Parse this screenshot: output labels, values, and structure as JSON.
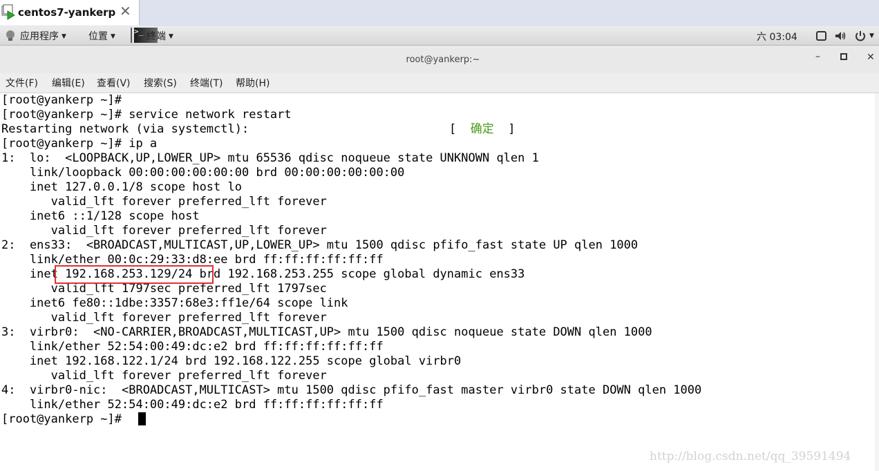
{
  "vm_tab": {
    "title": "centos7-yankerp",
    "close_glyph": "✕"
  },
  "gnome_bar": {
    "applications_label": "应用程序",
    "places_label": "位置",
    "terminal_label": "终端",
    "clock": "六 03:04"
  },
  "window": {
    "title": "root@yankerp:~",
    "minimize_glyph": "–",
    "maximize_glyph": "▫",
    "close_glyph": "✕"
  },
  "menu": [
    "文件(F)",
    "编辑(E)",
    "查看(V)",
    "搜索(S)",
    "终端(T)",
    "帮助(H)"
  ],
  "terminal": {
    "lines": [
      "[root@yankerp ~]#",
      "[root@yankerp ~]# service network restart",
      "Restarting network (via systemctl):",
      "[root@yankerp ~]# ip a",
      "1:  lo:  <LOOPBACK,UP,LOWER_UP> mtu 65536 qdisc noqueue state UNKNOWN qlen 1",
      "    link/loopback 00:00:00:00:00:00 brd 00:00:00:00:00:00",
      "    inet 127.0.0.1/8 scope host lo",
      "       valid_lft forever preferred_lft forever",
      "    inet6 ::1/128 scope host",
      "       valid_lft forever preferred_lft forever",
      "2:  ens33:  <BROADCAST,MULTICAST,UP,LOWER_UP> mtu 1500 qdisc pfifo_fast state UP qlen 1000",
      "    link/ether 00:0c:29:33:d8:ee brd ff:ff:ff:ff:ff:ff",
      "    inet 192.168.253.129/24 brd 192.168.253.255 scope global dynamic ens33",
      "       valid_lft 1797sec preferred_lft 1797sec",
      "    inet6 fe80::1dbe:3357:68e3:ff1e/64 scope link",
      "       valid_lft forever preferred_lft forever",
      "3:  virbr0:  <NO-CARRIER,BROADCAST,MULTICAST,UP> mtu 1500 qdisc noqueue state DOWN qlen 1000",
      "    link/ether 52:54:00:49:dc:e2 brd ff:ff:ff:ff:ff:ff",
      "    inet 192.168.122.1/24 brd 192.168.122.255 scope global virbr0",
      "       valid_lft forever preferred_lft forever",
      "4:  virbr0-nic:  <BROADCAST,MULTICAST> mtu 1500 qdisc pfifo_fast master virbr0 state DOWN qlen 1000",
      "    link/ether 52:54:00:49:dc:e2 brd ff:ff:ff:ff:ff:ff",
      "[root@yankerp ~]#"
    ],
    "ok_open": "[  ",
    "ok_text": "确定",
    "ok_close": "  ]"
  },
  "watermark": "http://blog.csdn.net/qq_39591494",
  "colors": {
    "ok_green": "#4a9a1a",
    "highlight_red": "#e03030"
  }
}
